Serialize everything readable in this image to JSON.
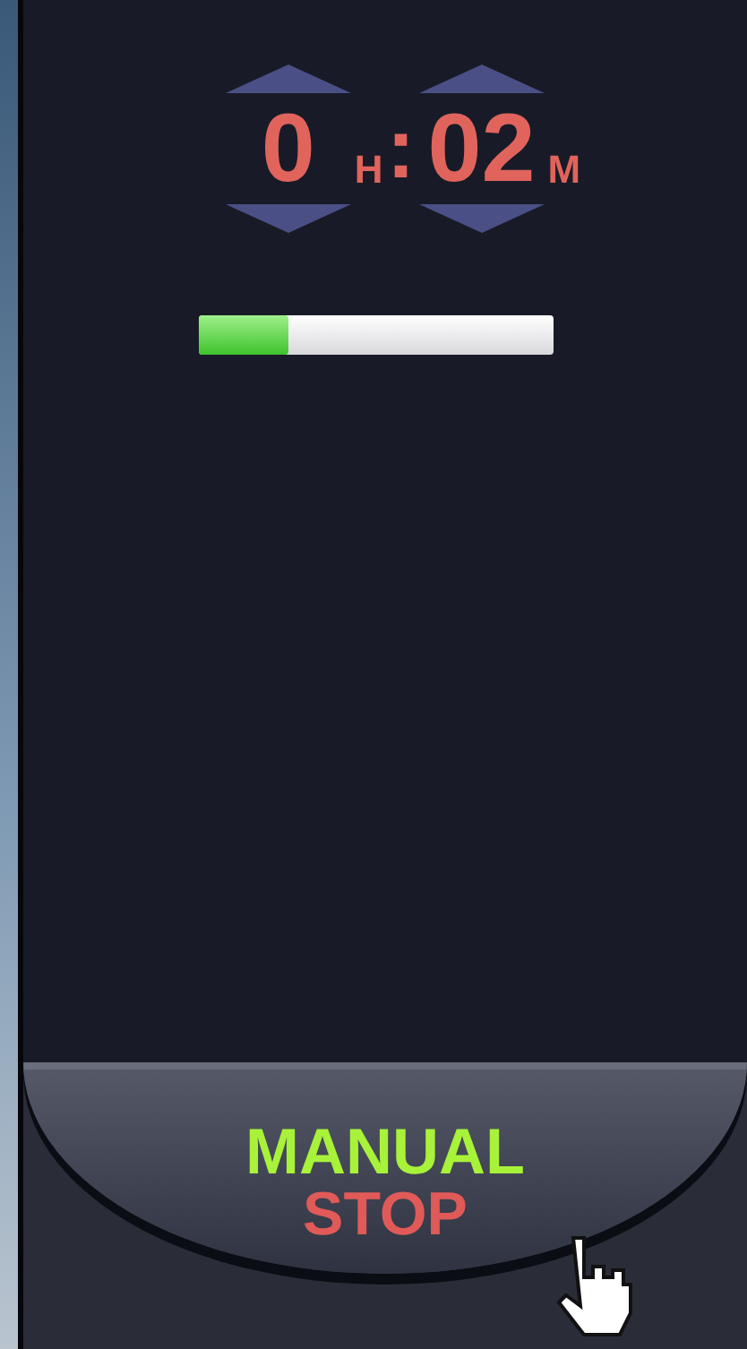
{
  "timer": {
    "hours": "0",
    "hours_unit": "H",
    "separator": ":",
    "minutes": "02",
    "minutes_unit": "M"
  },
  "progress": {
    "level": 0.25
  },
  "stop_button": {
    "line_1": "MANUAL",
    "line_2": "STOP"
  }
}
